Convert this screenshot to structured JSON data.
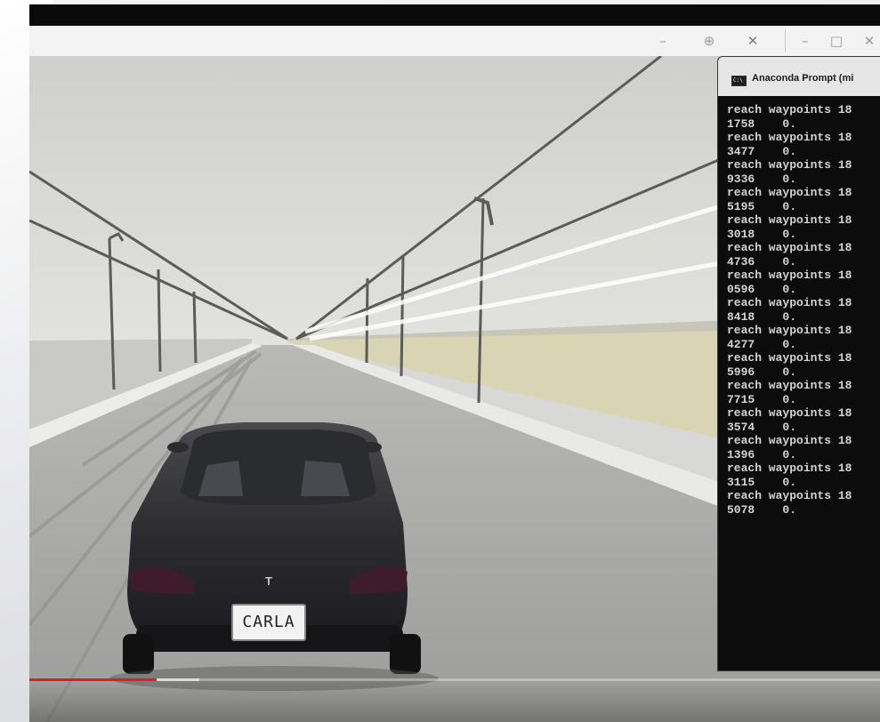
{
  "terminal": {
    "title": "Anaconda Prompt (mi",
    "icon_glyph": "C:\\",
    "lines": [
      "reach waypoints 18",
      "1758    0.",
      "reach waypoints 18",
      "3477    0.",
      "reach waypoints 18",
      "9336    0.",
      "reach waypoints 18",
      "5195    0.",
      "reach waypoints 18",
      "3018    0.",
      "reach waypoints 18",
      "4736    0.",
      "reach waypoints 18",
      "0596    0.",
      "reach waypoints 18",
      "8418    0.",
      "reach waypoints 18",
      "4277    0.",
      "reach waypoints 18",
      "5996    0.",
      "reach waypoints 18",
      "7715    0.",
      "reach waypoints 18",
      "3574    0.",
      "reach waypoints 18",
      "1396    0.",
      "reach waypoints 18",
      "3115    0.",
      "reach waypoints 18",
      "5078    0."
    ]
  },
  "carla_window": {
    "controls": {
      "minimize": "–",
      "zoom": "⊕",
      "close": "✕"
    }
  },
  "terminal_window": {
    "controls": {
      "minimize": "–",
      "maximize": "□",
      "close": "✕"
    }
  },
  "scene": {
    "license_plate": "CARLA",
    "car_badge": "T"
  },
  "video": {
    "progress_fraction": 0.15,
    "buffer_fraction": 0.2
  },
  "colors": {
    "progress": "#e11d1d",
    "terminal_bg": "#0c0c0c",
    "terminal_text": "#d4d4d4"
  }
}
